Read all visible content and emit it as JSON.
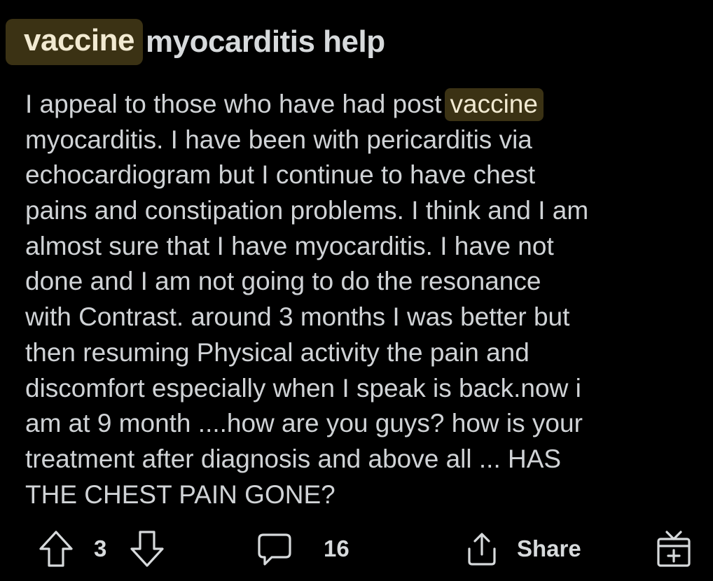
{
  "post": {
    "title": {
      "highlight": "vaccine",
      "rest": "myocarditis help"
    },
    "body": {
      "lines": [
        "I appeal to those who have had post",
        "myocarditis. I have been with pericarditis via",
        "echocardiogram but I continue to have chest",
        "pains and constipation problems. I think and I am",
        "almost sure that I have myocarditis.  I have not",
        "done and I am not going to do the resonance",
        "with Contrast. around 3 months I was better but",
        "then resuming Physical activity the pain and",
        "discomfort especially when I speak is back.now i",
        "am at 9 month ....how are you guys? how is your",
        "treatment after diagnosis and above all ... HAS",
        "THE CHEST PAIN GONE?"
      ],
      "line0_highlight": "vaccine"
    },
    "actions": {
      "vote_count": "3",
      "comment_count": "16",
      "share_label": "Share"
    },
    "icons": {
      "upvote": "upvote-arrow-icon",
      "downvote": "downvote-arrow-icon",
      "comment": "comment-bubble-icon",
      "share": "share-upload-icon",
      "award": "gift-award-icon"
    },
    "colors": {
      "background": "#000000",
      "text": "#d7dadc",
      "highlight_bg": "#3b3214",
      "highlight_text": "#f2ead2"
    }
  }
}
